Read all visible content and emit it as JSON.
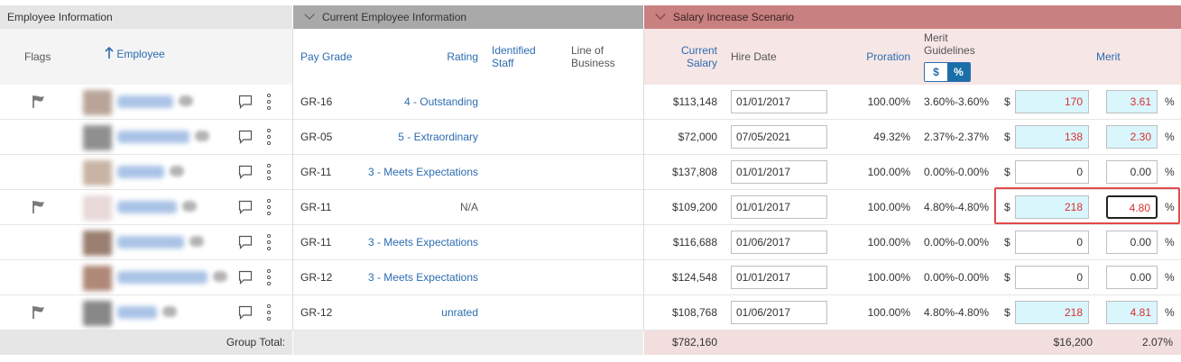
{
  "groups": {
    "employee_info": "Employee Information",
    "current_info": "Current Employee Information",
    "salary_scenario": "Salary Increase Scenario"
  },
  "columns": {
    "flags": "Flags",
    "employee": "Employee",
    "pay_grade": "Pay Grade",
    "rating": "Rating",
    "identified_staff": "Identified Staff",
    "line_of_business": "Line of Business",
    "current_salary": "Current Salary",
    "hire_date": "Hire Date",
    "proration": "Proration",
    "merit_guidelines": "Merit Guidelines",
    "merit": "Merit",
    "toggle_dollar": "$",
    "toggle_percent": "%"
  },
  "rows": [
    {
      "flag": true,
      "pay_grade": "GR-16",
      "rating": "4 - Outstanding",
      "rating_link": true,
      "salary": "$113,148",
      "hire_date": "01/01/2017",
      "proration": "100.00%",
      "guidelines": "3.60%-3.60%",
      "merit_amt": "170",
      "merit_pct": "3.61",
      "highlight": true
    },
    {
      "flag": false,
      "pay_grade": "GR-05",
      "rating": "5 - Extraordinary",
      "rating_link": true,
      "salary": "$72,000",
      "hire_date": "07/05/2021",
      "proration": "49.32%",
      "guidelines": "2.37%-2.37%",
      "merit_amt": "138",
      "merit_pct": "2.30",
      "highlight": true
    },
    {
      "flag": false,
      "pay_grade": "GR-11",
      "rating": "3 - Meets Expectations",
      "rating_link": true,
      "salary": "$137,808",
      "hire_date": "01/01/2017",
      "proration": "100.00%",
      "guidelines": "0.00%-0.00%",
      "merit_amt": "0",
      "merit_pct": "0.00",
      "highlight": false
    },
    {
      "flag": true,
      "pay_grade": "GR-11",
      "rating": "N/A",
      "rating_link": false,
      "salary": "$109,200",
      "hire_date": "01/01/2017",
      "proration": "100.00%",
      "guidelines": "4.80%-4.80%",
      "merit_amt": "218",
      "merit_pct": "4.80",
      "highlight": true
    },
    {
      "flag": false,
      "pay_grade": "GR-11",
      "rating": "3 - Meets Expectations",
      "rating_link": true,
      "salary": "$116,688",
      "hire_date": "01/06/2017",
      "proration": "100.00%",
      "guidelines": "0.00%-0.00%",
      "merit_amt": "0",
      "merit_pct": "0.00",
      "highlight": false
    },
    {
      "flag": false,
      "pay_grade": "GR-12",
      "rating": "3 - Meets Expectations",
      "rating_link": true,
      "salary": "$124,548",
      "hire_date": "01/01/2017",
      "proration": "100.00%",
      "guidelines": "0.00%-0.00%",
      "merit_amt": "0",
      "merit_pct": "0.00",
      "highlight": false
    },
    {
      "flag": true,
      "pay_grade": "GR-12",
      "rating": "unrated",
      "rating_link": true,
      "salary": "$108,768",
      "hire_date": "01/06/2017",
      "proration": "100.00%",
      "guidelines": "4.80%-4.80%",
      "merit_amt": "218",
      "merit_pct": "4.81",
      "highlight": true
    }
  ],
  "total": {
    "label": "Group Total:",
    "salary": "$782,160",
    "merit_amt": "$16,200",
    "merit_pct": "2.07%"
  },
  "currency_symbol": "$",
  "percent_symbol": "%",
  "colors": {
    "accent": "#2b6cb0",
    "highlight_input": "#d9f6fd",
    "changed_value": "#d93030",
    "salary_group": "#c98080"
  }
}
